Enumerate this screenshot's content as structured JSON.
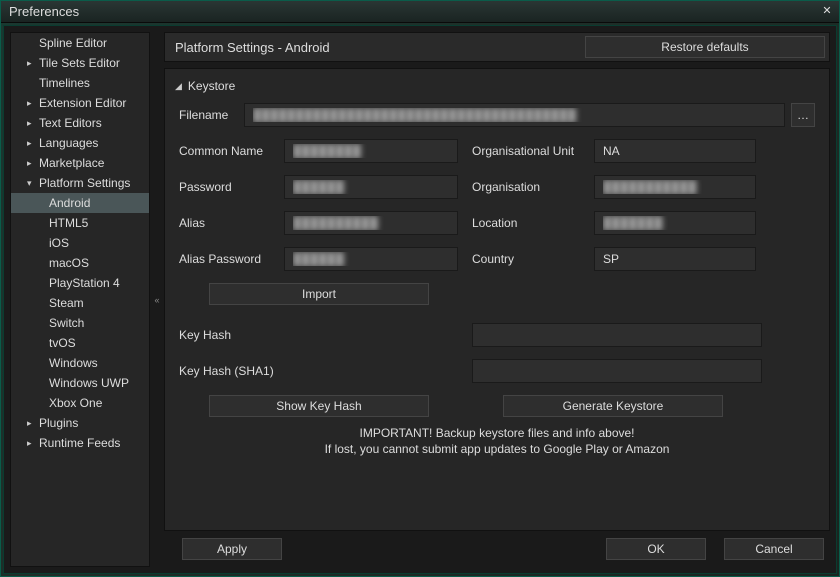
{
  "window": {
    "title": "Preferences"
  },
  "sidebar": {
    "items": [
      {
        "label": "Spline Editor",
        "level": 1,
        "arrow": ""
      },
      {
        "label": "Tile Sets Editor",
        "level": 1,
        "arrow": "▶"
      },
      {
        "label": "Timelines",
        "level": 1,
        "arrow": ""
      },
      {
        "label": "Extension Editor",
        "level": 1,
        "arrow": "▶"
      },
      {
        "label": "Text Editors",
        "level": 1,
        "arrow": "▶"
      },
      {
        "label": "Languages",
        "level": 1,
        "arrow": "▶"
      },
      {
        "label": "Marketplace",
        "level": 1,
        "arrow": "▶"
      },
      {
        "label": "Platform Settings",
        "level": 1,
        "arrow": "▴",
        "expanded": true
      },
      {
        "label": "Android",
        "level": 2,
        "selected": true
      },
      {
        "label": "HTML5",
        "level": 2
      },
      {
        "label": "iOS",
        "level": 2
      },
      {
        "label": "macOS",
        "level": 2
      },
      {
        "label": "PlayStation 4",
        "level": 2
      },
      {
        "label": "Steam",
        "level": 2
      },
      {
        "label": "Switch",
        "level": 2
      },
      {
        "label": "tvOS",
        "level": 2
      },
      {
        "label": "Windows",
        "level": 2
      },
      {
        "label": "Windows UWP",
        "level": 2
      },
      {
        "label": "Xbox One",
        "level": 2
      },
      {
        "label": "Plugins",
        "level": 1,
        "arrow": "▶"
      },
      {
        "label": "Runtime Feeds",
        "level": 1,
        "arrow": "▶"
      }
    ]
  },
  "collapse_handle": "«",
  "panel": {
    "title": "Platform Settings - Android",
    "restore_defaults": "Restore defaults"
  },
  "keystore": {
    "section_title": "Keystore",
    "labels": {
      "filename": "Filename",
      "common_name": "Common Name",
      "org_unit": "Organisational Unit",
      "password": "Password",
      "organisation": "Organisation",
      "alias": "Alias",
      "location": "Location",
      "alias_password": "Alias Password",
      "country": "Country",
      "key_hash": "Key Hash",
      "key_hash_sha1": "Key Hash (SHA1)"
    },
    "values": {
      "filename": "██████████████████████████████████████",
      "common_name": "████████",
      "org_unit": "NA",
      "password": "██████",
      "organisation": "███████████",
      "alias": "██████████",
      "location": "███████",
      "alias_password": "██████",
      "country": "SP",
      "key_hash": "",
      "key_hash_sha1": ""
    },
    "buttons": {
      "browse": "…",
      "import": "Import",
      "show_key_hash": "Show Key Hash",
      "generate_keystore": "Generate Keystore"
    },
    "warning_line1": "IMPORTANT! Backup keystore files and info above!",
    "warning_line2": "If lost, you cannot submit app updates to Google Play or Amazon"
  },
  "footer": {
    "apply": "Apply",
    "ok": "OK",
    "cancel": "Cancel"
  }
}
